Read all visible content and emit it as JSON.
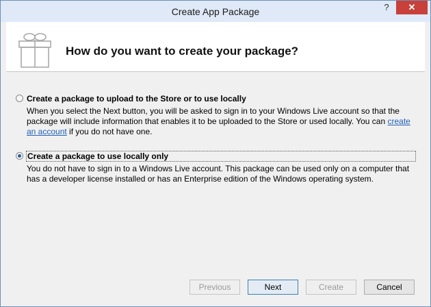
{
  "window": {
    "title": "Create App Package",
    "help_label": "?",
    "close_label": "✕"
  },
  "header": {
    "title": "How do you want to create your package?",
    "icon": "gift-box-icon"
  },
  "options": [
    {
      "label": "Create a package to upload to the Store or to use locally",
      "selected": false,
      "desc_pre": "When you select the Next button, you will be asked to sign in to your Windows Live account so that the package will include information that enables it to be uploaded to the Store or used locally. You can ",
      "link": "create an account",
      "desc_post": " if you do not have one."
    },
    {
      "label": "Create a package to use locally only",
      "selected": true,
      "desc": "You do not have to sign in to a Windows Live account. This package can be used only on a computer that has a developer license installed or has an Enterprise edition of the Windows operating system."
    }
  ],
  "buttons": {
    "previous": "Previous",
    "next": "Next",
    "create": "Create",
    "cancel": "Cancel"
  }
}
